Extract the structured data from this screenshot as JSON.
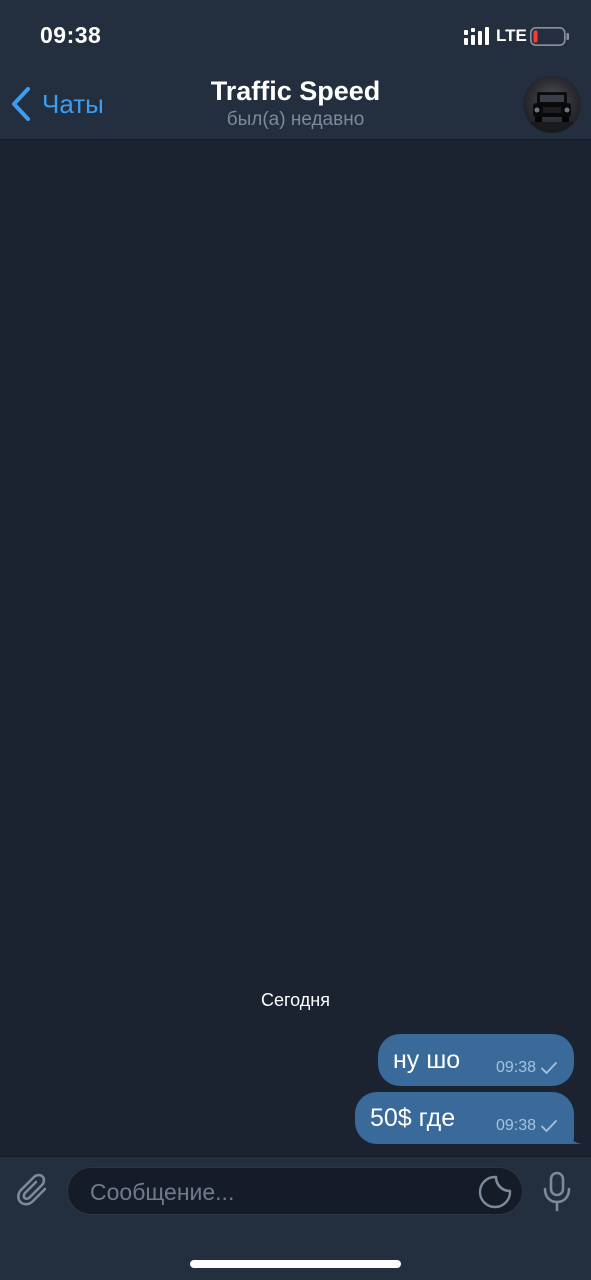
{
  "status_bar": {
    "time": "09:38",
    "network": "LTE",
    "icons": [
      "signal-icon",
      "battery-low-icon"
    ]
  },
  "header": {
    "back_label": "Чаты",
    "title": "Traffic Speed",
    "subtitle": "был(а) недавно",
    "icons": [
      "chevron-left-icon",
      "avatar-car-photo"
    ]
  },
  "chat": {
    "date_separator": "Сегодня",
    "messages": [
      {
        "text": "ну шо",
        "time": "09:38",
        "status": "sent"
      },
      {
        "text": "50$ где",
        "time": "09:38",
        "status": "sent"
      }
    ]
  },
  "input_bar": {
    "placeholder": "Сообщение...",
    "value": "",
    "icons": [
      "paperclip-icon",
      "sticker-icon",
      "microphone-icon"
    ]
  },
  "colors": {
    "background": "#1b2331",
    "bar": "#232e3e",
    "accent": "#3d9df0",
    "bubble": "#3a6a9a",
    "subtle_text": "#7c8a9c"
  }
}
